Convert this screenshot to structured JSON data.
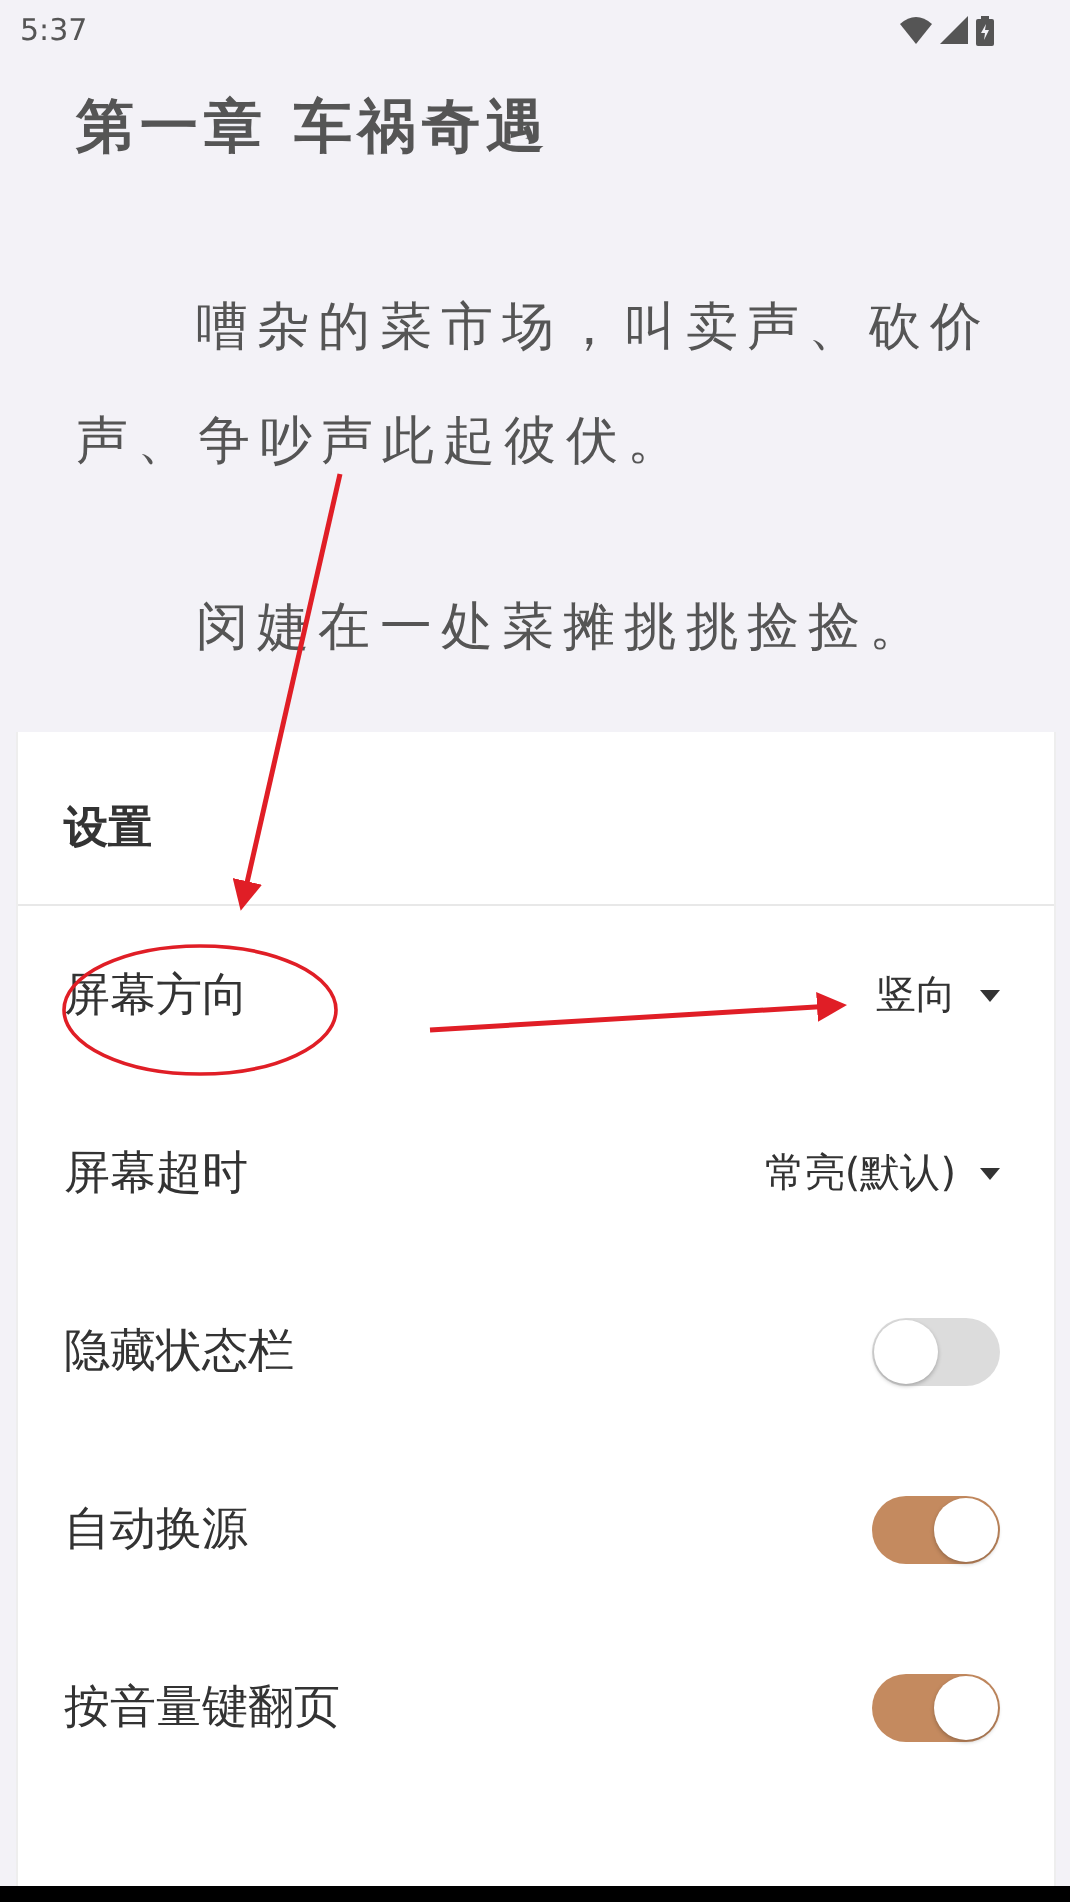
{
  "status_bar": {
    "time": "5:37"
  },
  "chapter": {
    "title": "第一章 车祸奇遇",
    "paragraphs": [
      "嘈杂的菜市场，叫卖声、砍价声、争吵声此起彼伏。",
      "闵婕在一处菜摊挑挑捡捡。"
    ]
  },
  "settings": {
    "title": "设置",
    "items": [
      {
        "kind": "dropdown",
        "label": "屏幕方向",
        "value": "竖向"
      },
      {
        "kind": "dropdown",
        "label": "屏幕超时",
        "value": "常亮(默认)"
      },
      {
        "kind": "toggle",
        "label": "隐藏状态栏",
        "on": false
      },
      {
        "kind": "toggle",
        "label": "自动换源",
        "on": true
      },
      {
        "kind": "toggle",
        "label": "按音量键翻页",
        "on": true
      }
    ]
  }
}
